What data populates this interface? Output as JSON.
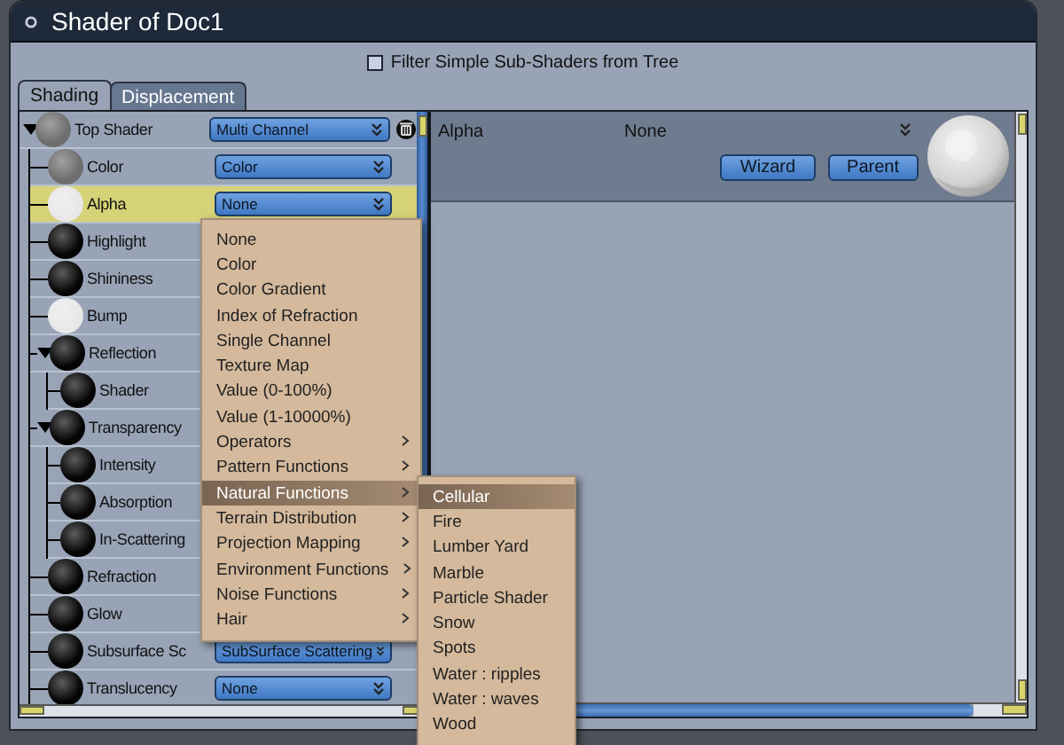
{
  "window": {
    "title": "Shader of Doc1"
  },
  "filter": {
    "label": "Filter Simple Sub-Shaders from Tree",
    "checked": false
  },
  "tabs": [
    {
      "label": "Shading",
      "selected": true
    },
    {
      "label": "Displacement",
      "selected": false
    }
  ],
  "tree": [
    {
      "label": "Top Shader",
      "color": "#6e6e6e",
      "value": "Multi Channel",
      "selected": false,
      "expanded": true,
      "children": [
        {
          "label": "Color",
          "color": "#6e6e6e",
          "value": "Color",
          "selected": false
        },
        {
          "label": "Alpha",
          "color": "#e8e8e8",
          "value": "None",
          "selected": true
        },
        {
          "label": "Highlight",
          "color": "#050505",
          "selected": false
        },
        {
          "label": "Shininess",
          "color": "#050505",
          "selected": false
        },
        {
          "label": "Bump",
          "color": "#e8e8e8",
          "selected": false
        },
        {
          "label": "Reflection",
          "color": "#050505",
          "selected": false,
          "expanded": true,
          "children": [
            {
              "label": "Shader",
              "color": "#050505",
              "selected": false
            }
          ]
        },
        {
          "label": "Transparency",
          "color": "#050505",
          "selected": false,
          "expanded": true,
          "children": [
            {
              "label": "Intensity",
              "color": "#050505",
              "selected": false
            },
            {
              "label": "Absorption",
              "color": "#050505",
              "selected": false
            },
            {
              "label": "In-Scattering",
              "color": "#050505",
              "selected": false
            }
          ]
        },
        {
          "label": "Refraction",
          "color": "#050505",
          "selected": false
        },
        {
          "label": "Glow",
          "color": "#050505",
          "selected": false
        },
        {
          "label": "Subsurface Sc",
          "color": "#050505",
          "value": "SubSurface Scattering",
          "selected": false
        },
        {
          "label": "Translucency",
          "color": "#050505",
          "value": "None",
          "selected": false
        }
      ]
    }
  ],
  "detail": {
    "label": "Alpha",
    "value": "None",
    "buttons": [
      "Wizard",
      "Parent"
    ]
  },
  "menu": [
    {
      "label": "None",
      "submenu": false,
      "selected": false
    },
    {
      "label": "Color",
      "submenu": false,
      "selected": false
    },
    {
      "label": "Color Gradient",
      "submenu": false,
      "selected": false
    },
    {
      "label": "Index of Refraction",
      "submenu": false,
      "selected": false
    },
    {
      "label": "Single Channel",
      "submenu": false,
      "selected": false
    },
    {
      "label": "Texture Map",
      "submenu": false,
      "selected": false
    },
    {
      "label": "Value (0-100%)",
      "submenu": false,
      "selected": false
    },
    {
      "label": "Value (1-10000%)",
      "submenu": false,
      "selected": false
    },
    {
      "label": "Operators",
      "submenu": true,
      "selected": false
    },
    {
      "label": "Pattern Functions",
      "submenu": true,
      "selected": false
    },
    {
      "label": "Natural Functions",
      "submenu": true,
      "selected": true
    },
    {
      "label": "Terrain Distribution",
      "submenu": true,
      "selected": false
    },
    {
      "label": "Projection Mapping",
      "submenu": true,
      "selected": false
    },
    {
      "label": "Environment Functions",
      "submenu": true,
      "selected": false
    },
    {
      "label": "Noise Functions",
      "submenu": true,
      "selected": false
    },
    {
      "label": "Hair",
      "submenu": true,
      "selected": false
    }
  ],
  "submenu": [
    {
      "label": "Cellular",
      "selected": true
    },
    {
      "label": "Fire",
      "selected": false
    },
    {
      "label": "Lumber Yard",
      "selected": false
    },
    {
      "label": "Marble",
      "selected": false
    },
    {
      "label": "Particle Shader",
      "selected": false
    },
    {
      "label": "Snow",
      "selected": false
    },
    {
      "label": "Spots",
      "selected": false
    },
    {
      "label": "Water : ripples",
      "selected": false
    },
    {
      "label": "Water : waves",
      "selected": false
    },
    {
      "label": "Wood",
      "selected": false
    }
  ]
}
